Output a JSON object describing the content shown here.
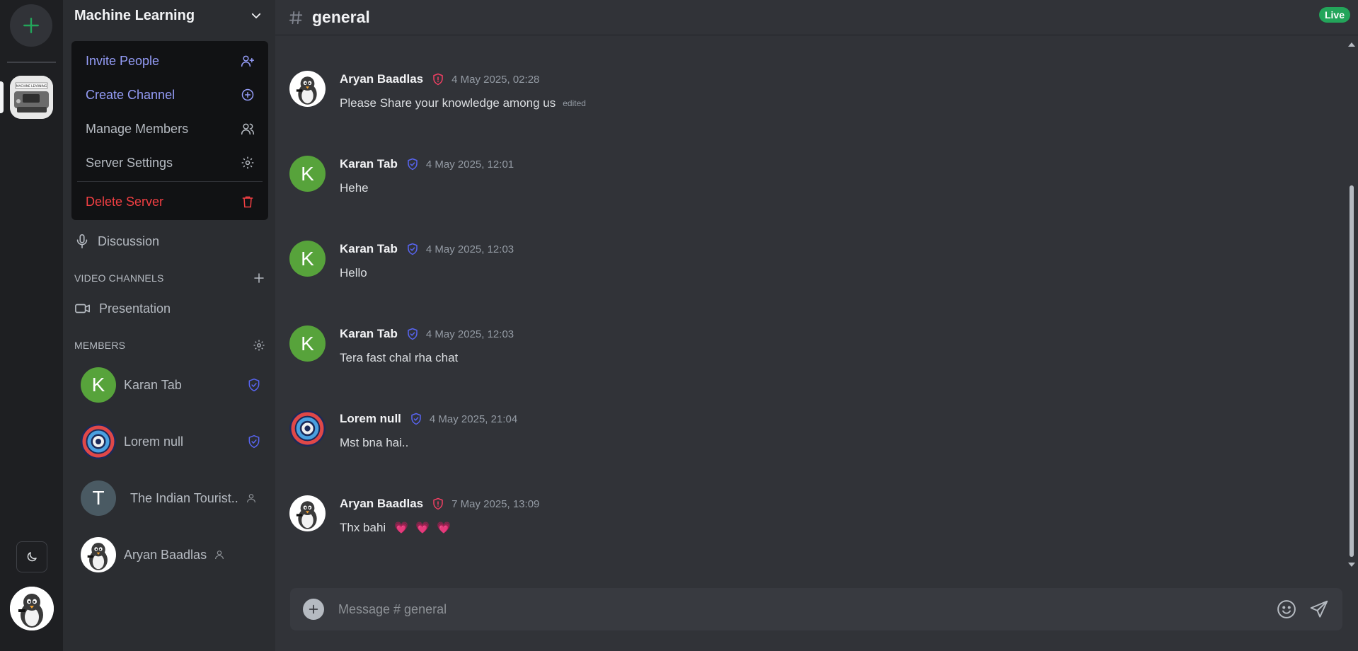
{
  "rail": {
    "add_label": "+",
    "server_image_text": "MACHINE LEARNING"
  },
  "server": {
    "name": "Machine Learning"
  },
  "menu": {
    "invite": "Invite People",
    "create_channel": "Create Channel",
    "manage_members": "Manage Members",
    "server_settings": "Server Settings",
    "delete_server": "Delete Server"
  },
  "channels": {
    "audio": [
      {
        "name": "Discussion"
      }
    ],
    "video_section": "VIDEO CHANNELS",
    "video": [
      {
        "name": "Presentation"
      }
    ]
  },
  "members": {
    "section": "MEMBERS",
    "list": [
      {
        "name": "Karan Tab",
        "initial": "K",
        "role": "moderator"
      },
      {
        "name": "Lorem null",
        "initial": "",
        "role": "moderator"
      },
      {
        "name": "The Indian Tourist..",
        "initial": "T",
        "role": "guest"
      },
      {
        "name": "Aryan Baadlas",
        "initial": "",
        "role": "guest"
      }
    ]
  },
  "chat": {
    "channel": "general",
    "live_label": "Live",
    "composer_placeholder": "Message # general",
    "messages": [
      {
        "author": "Aryan Baadlas",
        "role": "admin",
        "time": "4 May 2025, 02:28",
        "text": "Please Share your knowledge among us",
        "edited": "edited",
        "avatar": "penguin"
      },
      {
        "author": "Karan Tab",
        "role": "moderator",
        "time": "4 May 2025, 12:01",
        "text": "Hehe",
        "edited": "",
        "avatar": "K"
      },
      {
        "author": "Karan Tab",
        "role": "moderator",
        "time": "4 May 2025, 12:03",
        "text": "Hello",
        "edited": "",
        "avatar": "K"
      },
      {
        "author": "Karan Tab",
        "role": "moderator",
        "time": "4 May 2025, 12:03",
        "text": "Tera fast chal rha chat",
        "edited": "",
        "avatar": "K"
      },
      {
        "author": "Lorem null",
        "role": "moderator",
        "time": "4 May 2025, 21:04",
        "text": "Mst bna hai..",
        "edited": "",
        "avatar": "swirl"
      },
      {
        "author": "Aryan Baadlas",
        "role": "admin",
        "time": "7 May 2025, 13:09",
        "text": "Thx bahi",
        "edited": "",
        "avatar": "penguin",
        "emoji": [
          "💗",
          "💗",
          "💗"
        ]
      }
    ]
  },
  "colors": {
    "accent": "#949cf7",
    "danger": "#f23f43",
    "live": "#23a55a",
    "moderator_shield": "#5865f2",
    "admin_shield": "#f23f63"
  },
  "icons": {
    "menu": [
      "user-plus-icon",
      "plus-circle-icon",
      "users-icon",
      "gear-icon",
      "trash-icon"
    ],
    "chat": [
      "hash-icon",
      "emoji-icon",
      "send-icon",
      "plus-icon"
    ]
  }
}
